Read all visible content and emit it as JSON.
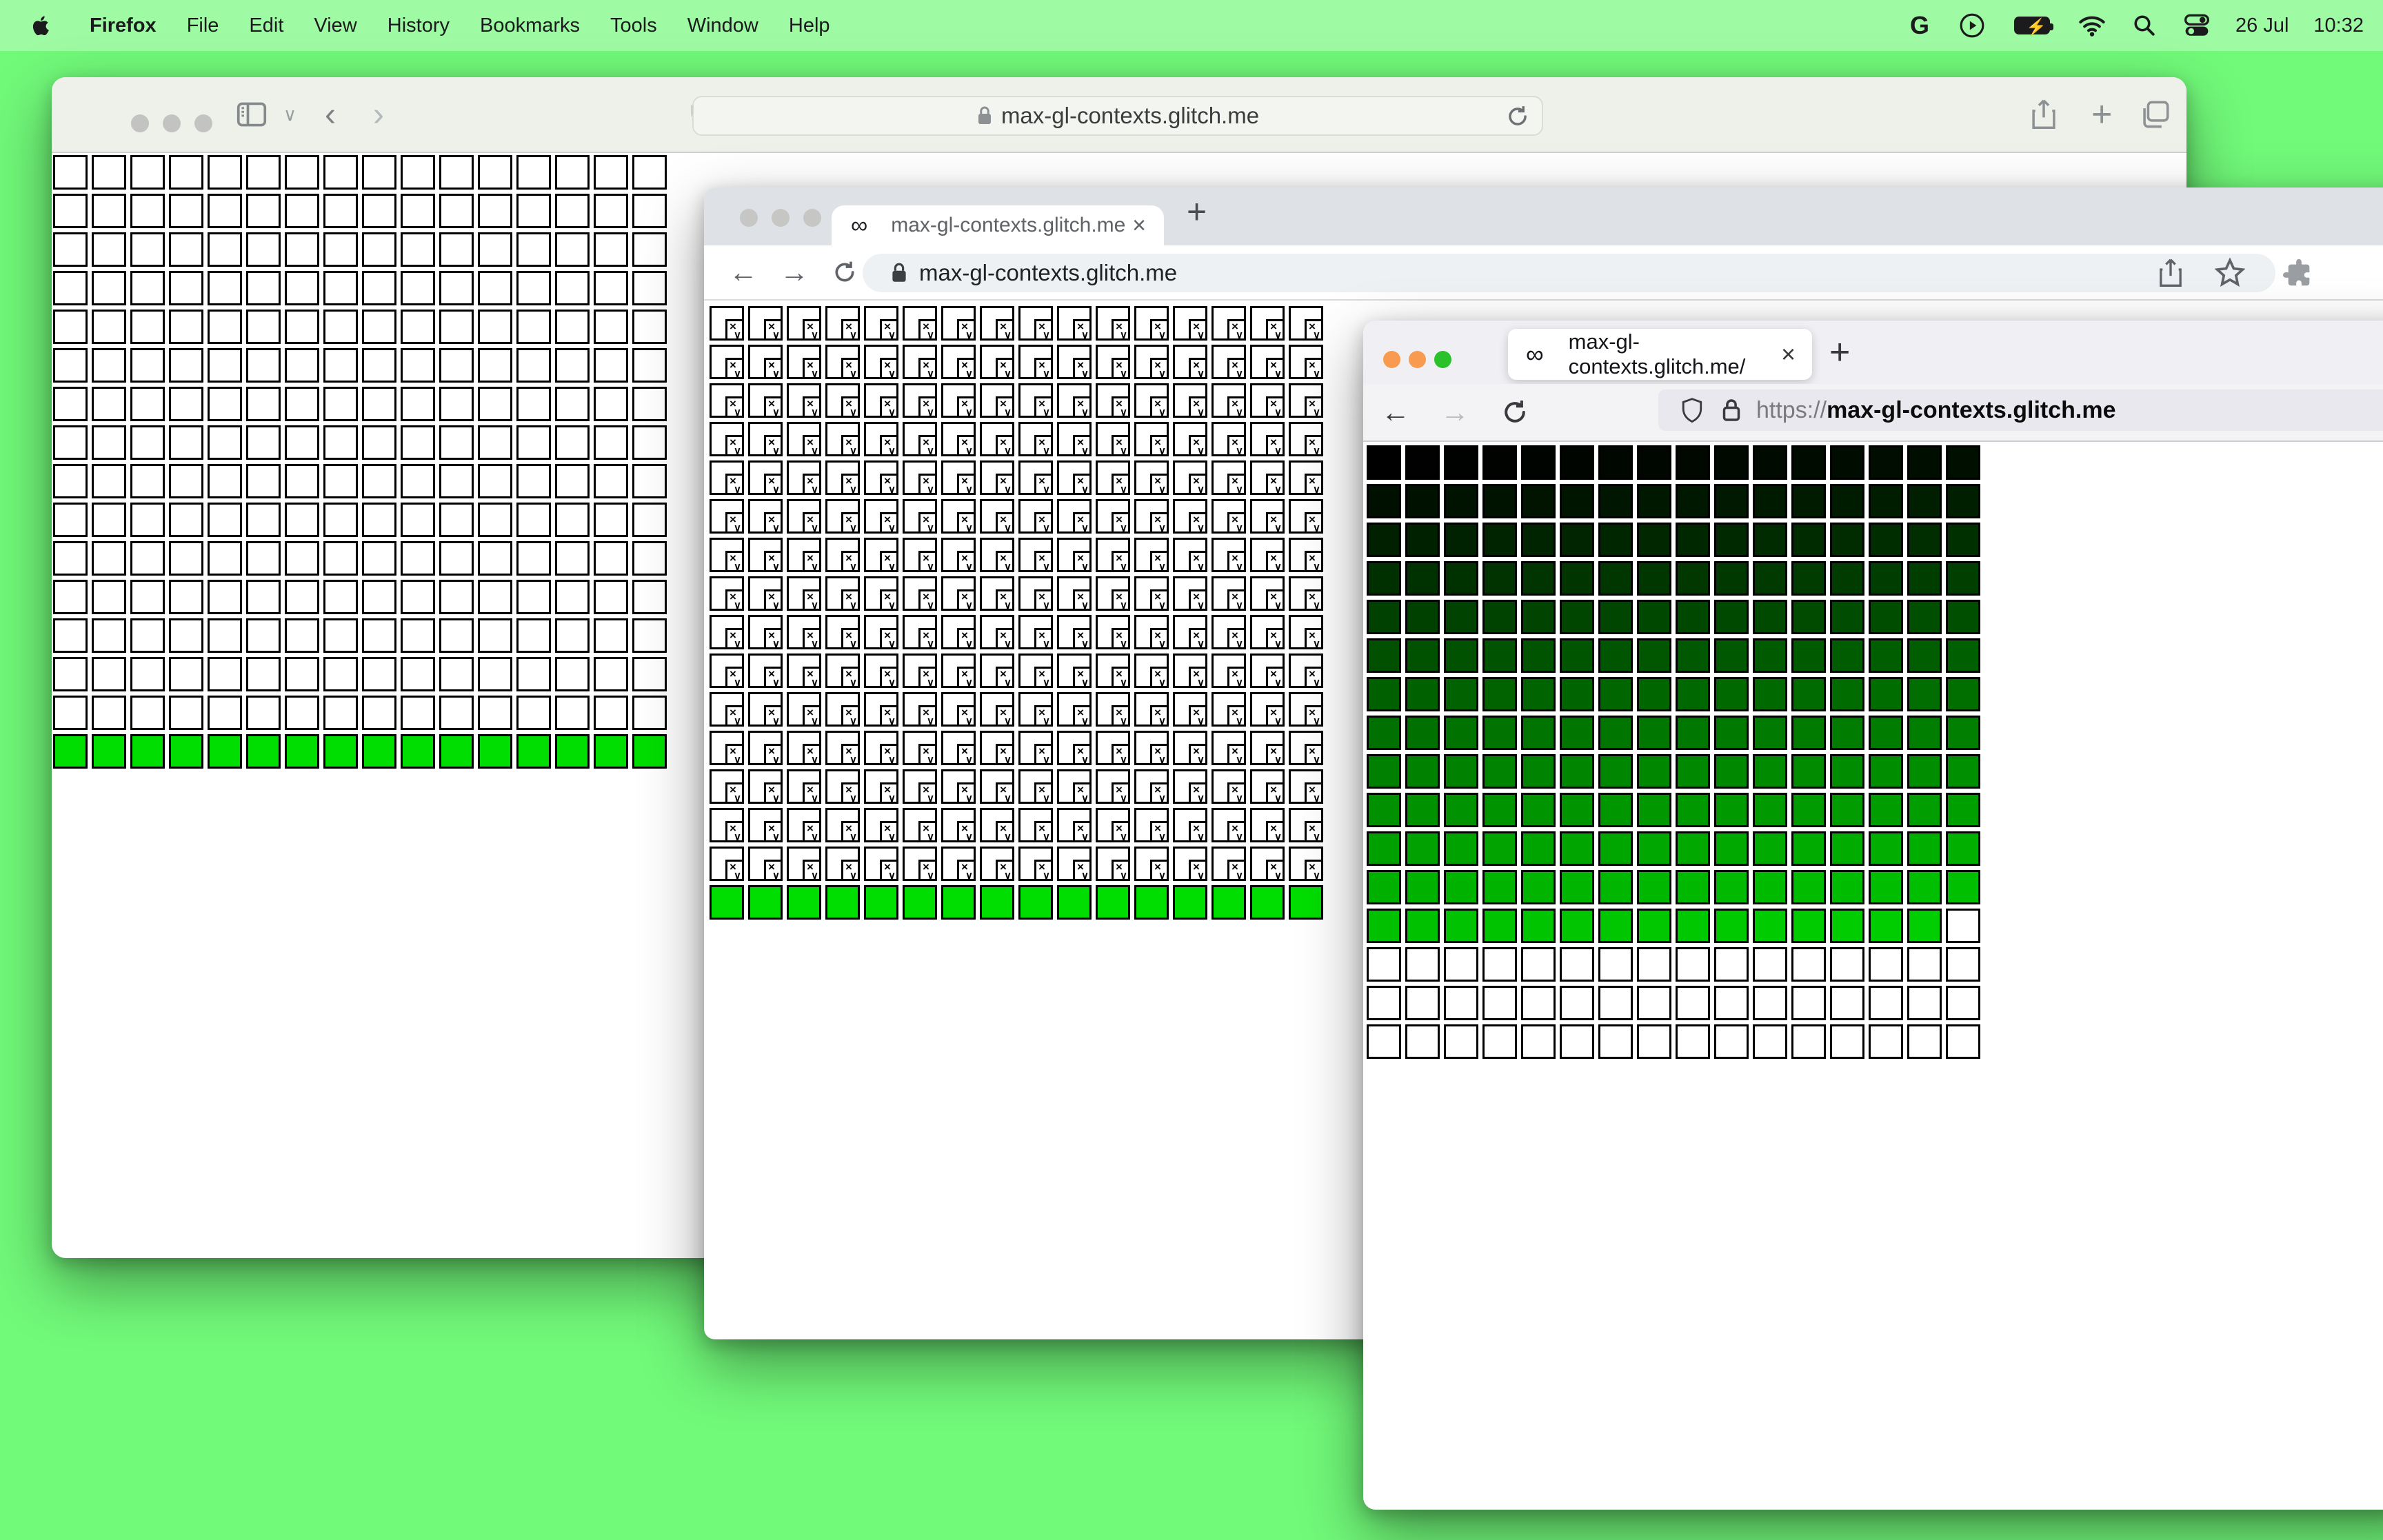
{
  "menu_bar": {
    "app_name": "Firefox",
    "items": [
      "File",
      "Edit",
      "View",
      "History",
      "Bookmarks",
      "Tools",
      "Window",
      "Help"
    ],
    "status": {
      "g_label": "G",
      "date": "26 Jul",
      "time": "10:32"
    }
  },
  "site": {
    "favicon": "∞",
    "close_glyph": "×",
    "plus_glyph": "+"
  },
  "safari": {
    "url": "max-gl-contexts.glitch.me"
  },
  "chrome": {
    "tab_title": "max-gl-contexts.glitch.me",
    "url": "max-gl-contexts.glitch.me"
  },
  "firefox": {
    "tab_title": "max-gl-contexts.glitch.me/",
    "url_scheme": "https://",
    "url_host": "max-gl-contexts.glitch.me",
    "back_glyph": "←",
    "forward_glyph": "→"
  },
  "broken_glyphs": {
    "x": "×",
    "wave": "∨"
  },
  "colors": {
    "desktop": "#71f979",
    "menubar": "#9efba3",
    "active_green": "#00dd00",
    "firefox_close_light": "#f89b50",
    "firefox_min_light": "#f89b50",
    "firefox_zoom_light": "#2bc12b",
    "inactive_light": "#c6c6c5"
  },
  "grids": {
    "safari": {
      "cols": 16,
      "rows": 16,
      "cells": [
        "WWWWWWWWWWWWWWWW",
        "WWWWWWWWWWWWWWWW",
        "WWWWWWWWWWWWWWWW",
        "WWWWWWWWWWWWWWWW",
        "WWWWWWWWWWWWWWWW",
        "WWWWWWWWWWWWWWWW",
        "WWWWWWWWWWWWWWWW",
        "WWWWWWWWWWWWWWWW",
        "WWWWWWWWWWWWWWWW",
        "WWWWWWWWWWWWWWWW",
        "WWWWWWWWWWWWWWWW",
        "WWWWWWWWWWWWWWWW",
        "WWWWWWWWWWWWWWWW",
        "WWWWWWWWWWWWWWWW",
        "WWWWWWWWWWWWWWWW",
        "GGGGGGGGGGGGGGGG"
      ]
    },
    "chrome": {
      "cols": 16,
      "rows": 16,
      "cells": [
        "BBBBBBBBBBBBBBBB",
        "BBBBBBBBBBBBBBBB",
        "BBBBBBBBBBBBBBBB",
        "BBBBBBBBBBBBBBBB",
        "BBBBBBBBBBBBBBBB",
        "BBBBBBBBBBBBBBBB",
        "BBBBBBBBBBBBBBBB",
        "BBBBBBBBBBBBBBBB",
        "BBBBBBBBBBBBBBBB",
        "BBBBBBBBBBBBBBBB",
        "BBBBBBBBBBBBBBBB",
        "BBBBBBBBBBBBBBBB",
        "BBBBBBBBBBBBBBBB",
        "BBBBBBBBBBBBBBBB",
        "BBBBBBBBBBBBBBBB",
        "GGGGGGGGGGGGGGGG"
      ]
    },
    "firefox": {
      "cols": 16,
      "rows": 16,
      "active_contexts": 207,
      "cells": [
        [
          0,
          1,
          2,
          3,
          4,
          5,
          6,
          7,
          8,
          9,
          10,
          11,
          12,
          13,
          14,
          15
        ],
        [
          16,
          17,
          18,
          19,
          20,
          21,
          22,
          23,
          24,
          25,
          26,
          27,
          28,
          29,
          30,
          31
        ],
        [
          32,
          33,
          34,
          35,
          36,
          37,
          38,
          39,
          40,
          41,
          42,
          43,
          44,
          45,
          46,
          47
        ],
        [
          48,
          49,
          50,
          51,
          52,
          53,
          54,
          55,
          56,
          57,
          58,
          59,
          60,
          61,
          62,
          63
        ],
        [
          64,
          65,
          66,
          67,
          68,
          69,
          70,
          71,
          72,
          73,
          74,
          75,
          76,
          77,
          78,
          79
        ],
        [
          80,
          81,
          82,
          83,
          84,
          85,
          86,
          87,
          88,
          89,
          90,
          91,
          92,
          93,
          94,
          95
        ],
        [
          96,
          97,
          98,
          99,
          100,
          101,
          102,
          103,
          104,
          105,
          106,
          107,
          108,
          109,
          110,
          111
        ],
        [
          112,
          113,
          114,
          115,
          116,
          117,
          118,
          119,
          120,
          121,
          122,
          123,
          124,
          125,
          126,
          127
        ],
        [
          128,
          129,
          130,
          131,
          132,
          133,
          134,
          135,
          136,
          137,
          138,
          139,
          140,
          141,
          142,
          143
        ],
        [
          144,
          145,
          146,
          147,
          148,
          149,
          150,
          151,
          152,
          153,
          154,
          155,
          156,
          157,
          158,
          159
        ],
        [
          160,
          161,
          162,
          163,
          164,
          165,
          166,
          167,
          168,
          169,
          170,
          171,
          172,
          173,
          174,
          175
        ],
        [
          176,
          177,
          178,
          179,
          180,
          181,
          182,
          183,
          184,
          185,
          186,
          187,
          188,
          189,
          190,
          191
        ],
        [
          192,
          193,
          194,
          195,
          196,
          197,
          198,
          199,
          200,
          201,
          202,
          203,
          204,
          205,
          206,
          null
        ],
        [
          null,
          null,
          null,
          null,
          null,
          null,
          null,
          null,
          null,
          null,
          null,
          null,
          null,
          null,
          null,
          null
        ],
        [
          null,
          null,
          null,
          null,
          null,
          null,
          null,
          null,
          null,
          null,
          null,
          null,
          null,
          null,
          null,
          null
        ],
        [
          null,
          null,
          null,
          null,
          null,
          null,
          null,
          null,
          null,
          null,
          null,
          null,
          null,
          null,
          null,
          null
        ]
      ]
    }
  }
}
